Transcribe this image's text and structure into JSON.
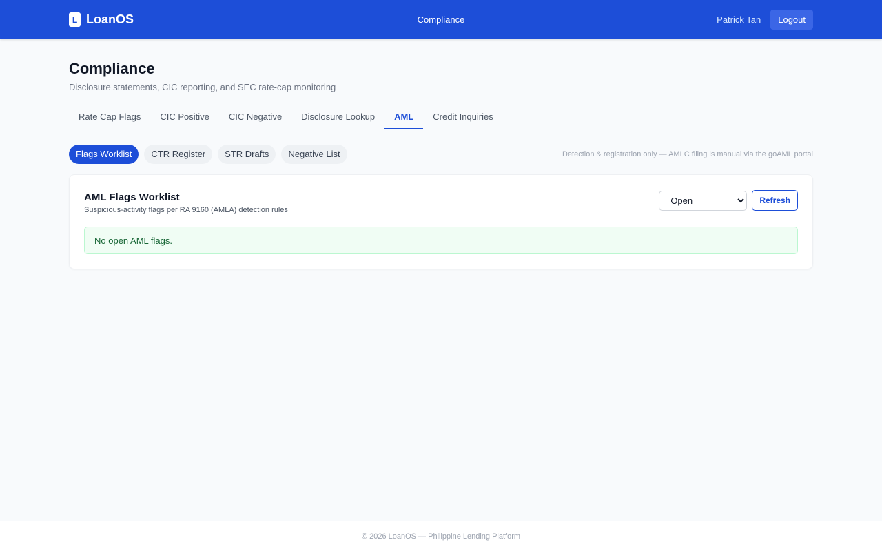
{
  "header": {
    "brand_letter": "L",
    "brand_name": "LoanOS",
    "nav_label": "Compliance",
    "user_name": "Patrick Tan",
    "logout_label": "Logout"
  },
  "page": {
    "title": "Compliance",
    "subtitle": "Disclosure statements, CIC reporting, and SEC rate-cap monitoring"
  },
  "tabs": [
    {
      "label": "Rate Cap Flags",
      "active": false
    },
    {
      "label": "CIC Positive",
      "active": false
    },
    {
      "label": "CIC Negative",
      "active": false
    },
    {
      "label": "Disclosure Lookup",
      "active": false
    },
    {
      "label": "AML",
      "active": true
    },
    {
      "label": "Credit Inquiries",
      "active": false
    }
  ],
  "subtabs": [
    {
      "label": "Flags Worklist",
      "active": true
    },
    {
      "label": "CTR Register",
      "active": false
    },
    {
      "label": "STR Drafts",
      "active": false
    },
    {
      "label": "Negative List",
      "active": false
    }
  ],
  "subtab_note": "Detection & registration only — AMLC filing is manual via the goAML portal",
  "card": {
    "title": "AML Flags Worklist",
    "subtitle": "Suspicious-activity flags per RA 9160 (AMLA) detection rules",
    "status_filter": "Open",
    "refresh_label": "Refresh",
    "empty_message": "No open AML flags."
  },
  "footer": {
    "text": "© 2026 LoanOS — Philippine Lending Platform"
  },
  "colors": {
    "primary": "#1d4ed8",
    "success_bg": "#f0fdf4",
    "success_text": "#166534"
  }
}
